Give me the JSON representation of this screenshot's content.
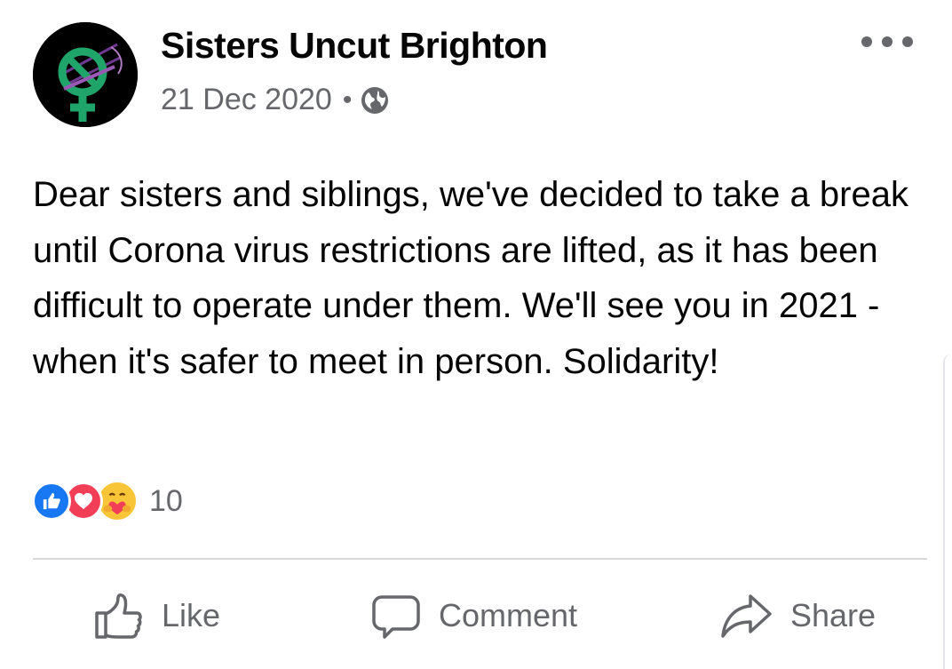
{
  "post": {
    "author": "Sisters Uncut Brighton",
    "date": "21 Dec 2020",
    "separator": "•",
    "privacy_icon": "globe-icon",
    "more_icon": "more-options-icon",
    "avatar_icon": "venus-symbol-logo",
    "text": "Dear sisters and siblings, we've decided to take a break until Corona virus restrictions are lifted, as it has been difficult to operate under them. We'll see you in 2021 - when it's safer to meet in person. Solidarity!",
    "reactions": {
      "types": [
        "like",
        "love",
        "care"
      ],
      "count": "10"
    }
  },
  "actions": {
    "like": {
      "label": "Like",
      "icon": "thumbs-up-icon"
    },
    "comment": {
      "label": "Comment",
      "icon": "speech-bubble-icon"
    },
    "share": {
      "label": "Share",
      "icon": "share-arrow-icon"
    }
  },
  "colors": {
    "text_primary": "#050505",
    "text_secondary": "#65676b",
    "like_blue": "#1877f2",
    "love_red": "#f33e58",
    "care_yellow": "#f7c537",
    "logo_green": "#1fa56a",
    "logo_purple": "#7a3fa0"
  }
}
